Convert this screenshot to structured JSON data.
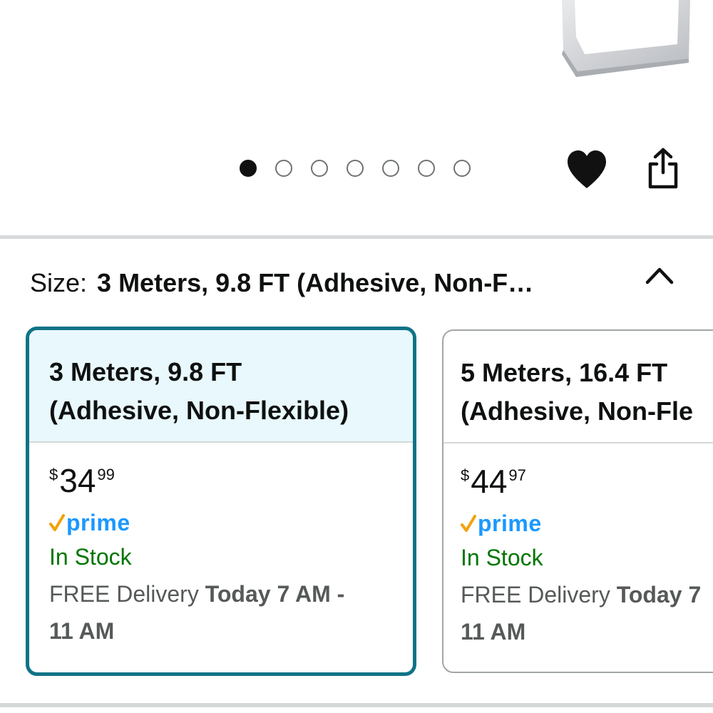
{
  "carousel": {
    "dot_count": 7,
    "active_index": 0
  },
  "actions": {
    "wishlist_icon": "heart-icon",
    "share_icon": "share-icon"
  },
  "size": {
    "label": "Size:",
    "selected_value": "3 Meters, 9.8 FT (Adhesive, Non-F…",
    "collapse_icon": "chevron-up-icon"
  },
  "options": [
    {
      "title_line1": "3 Meters, 9.8 FT",
      "title_line2": "(Adhesive, Non-Flexible)",
      "currency": "$",
      "price_whole": "34",
      "price_fraction": "99",
      "prime_label": "prime",
      "stock": "In Stock",
      "delivery_prefix": "FREE Delivery ",
      "delivery_bold": "Today 7 AM -",
      "delivery_line2": "11 AM",
      "selected": true
    },
    {
      "title_line1": "5 Meters, 16.4 FT",
      "title_line2": "(Adhesive, Non-Fle",
      "currency": "$",
      "price_whole": "44",
      "price_fraction": "97",
      "prime_label": "prime",
      "stock": "In Stock",
      "delivery_prefix": "FREE Delivery ",
      "delivery_bold": "Today 7",
      "delivery_line2": "11 AM",
      "selected": false
    }
  ],
  "colors": {
    "selected_border": "#0f7386",
    "selected_header_bg": "#e8f8fc",
    "prime_blue": "#1a98ff",
    "prime_check": "#f0a30a",
    "in_stock_green": "#007600"
  }
}
